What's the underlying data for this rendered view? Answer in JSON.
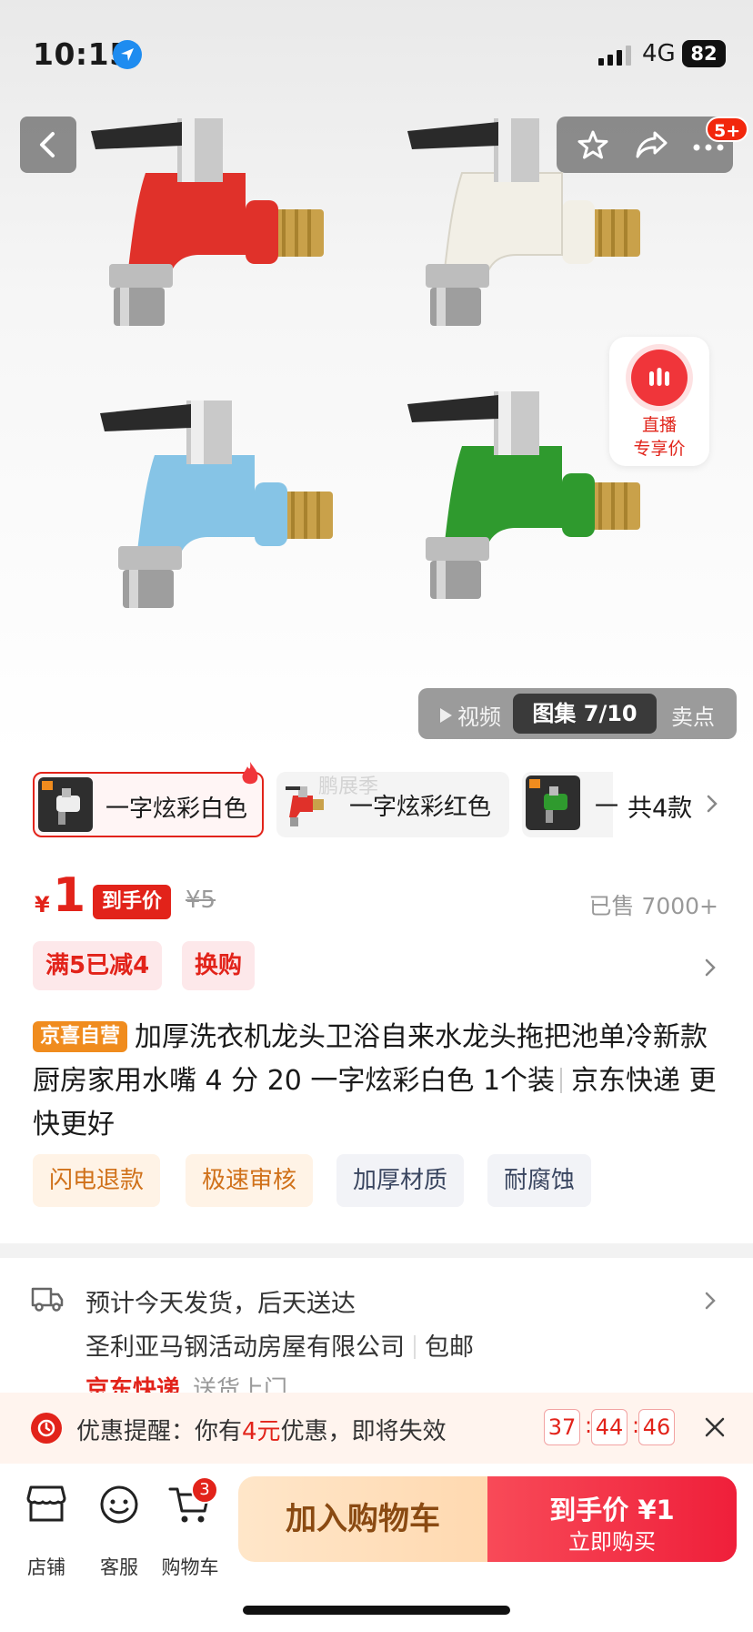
{
  "status_bar": {
    "time": "10:15",
    "network": "4G",
    "battery": "82"
  },
  "nav": {
    "notification_badge": "5+"
  },
  "live": {
    "line1": "直播",
    "line2": "专享价"
  },
  "gallery": {
    "video_label": "视频",
    "album_label": "图集 7/10",
    "selling_points_label": "卖点"
  },
  "sku": {
    "options": [
      {
        "label": "一字炫彩白色"
      },
      {
        "label": "一字炫彩红色"
      },
      {
        "label": "一"
      }
    ],
    "watermark": "鹏展季",
    "total_label": "共4款"
  },
  "price": {
    "currency": "¥",
    "value": "1",
    "tag": "到手价",
    "original": "¥5",
    "sold": "已售 7000+"
  },
  "promotions": [
    "满5已减4",
    "换购"
  ],
  "product": {
    "store_badge": "京喜自营",
    "title": "加厚洗衣机龙头卫浴自来水龙头拖把池单冷新款厨房家用水嘴 4 分 20 一字炫彩白色 1个装",
    "delivery_suffix": "京东快递 更快更好"
  },
  "feature_tags": [
    "闪电退款",
    "极速审核",
    "加厚材质",
    "耐腐蚀"
  ],
  "shipping": {
    "estimate": "预计今天发货，后天送达",
    "seller": "圣利亚马钢活动房屋有限公司",
    "free_shipping": "包邮",
    "carrier": "京东快递",
    "carrier_note": "送货上门"
  },
  "reminder": {
    "prefix": "优惠提醒：你有",
    "amount": "4元",
    "suffix": "优惠，即将失效",
    "countdown": [
      "37",
      "44",
      "46"
    ]
  },
  "bottom_bar": {
    "store_label": "店铺",
    "service_label": "客服",
    "cart_label": "购物车",
    "cart_count": "3",
    "add_to_cart": "加入购物车",
    "buy_price_label": "到手价 ¥1",
    "buy_now": "立即购买"
  },
  "colors": {
    "accent": "#e2231a",
    "store_badge": "#f08c1e"
  },
  "faucet_colors": [
    "#e0312a",
    "#f2efe6",
    "#86c4e6",
    "#2f9a2e"
  ]
}
